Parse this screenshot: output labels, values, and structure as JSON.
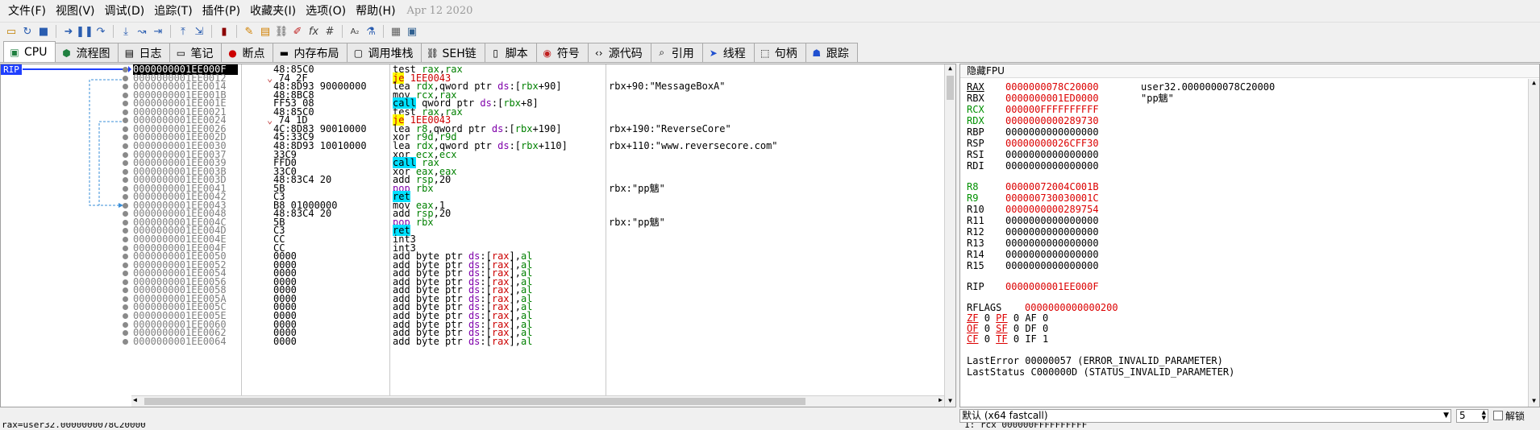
{
  "menu": [
    "文件(F)",
    "视图(V)",
    "调试(D)",
    "追踪(T)",
    "插件(P)",
    "收藏夹(I)",
    "选项(O)",
    "帮助(H)"
  ],
  "menu_date": "Apr 12 2020",
  "tabs": [
    {
      "label": "CPU",
      "icon": "cpu-icon",
      "active": true
    },
    {
      "label": "流程图",
      "icon": "graph-icon"
    },
    {
      "label": "日志",
      "icon": "log-icon"
    },
    {
      "label": "笔记",
      "icon": "notes-icon"
    },
    {
      "label": "断点",
      "icon": "breakpoint-icon"
    },
    {
      "label": "内存布局",
      "icon": "memory-icon"
    },
    {
      "label": "调用堆栈",
      "icon": "callstack-icon"
    },
    {
      "label": "SEH链",
      "icon": "seh-icon"
    },
    {
      "label": "脚本",
      "icon": "script-icon"
    },
    {
      "label": "符号",
      "icon": "symbol-icon"
    },
    {
      "label": "源代码",
      "icon": "source-icon"
    },
    {
      "label": "引用",
      "icon": "reference-icon"
    },
    {
      "label": "线程",
      "icon": "thread-icon"
    },
    {
      "label": "句柄",
      "icon": "handle-icon"
    },
    {
      "label": "跟踪",
      "icon": "trace-icon"
    }
  ],
  "rip_label": "RIP",
  "disasm": [
    {
      "addr": "0000000001EE000F",
      "bytes": "48:85C0",
      "dis": "test rax,rax",
      "cmt": "",
      "cur": true
    },
    {
      "addr": "0000000001EE0012",
      "bytes": "74 2F",
      "dis": "je 1EE0043",
      "cmt": "",
      "jmp": true,
      "arrow": "v"
    },
    {
      "addr": "0000000001EE0014",
      "bytes": "48:8D93 90000000",
      "dis": "lea rdx,qword ptr ds:[rbx+90]",
      "cmt": "rbx+90:\"MessageBoxA\""
    },
    {
      "addr": "0000000001EE001B",
      "bytes": "48:8BC8",
      "dis": "mov rcx,rax",
      "cmt": ""
    },
    {
      "addr": "0000000001EE001E",
      "bytes": "FF53 08",
      "dis": "call qword ptr ds:[rbx+8]",
      "cmt": "",
      "call": true
    },
    {
      "addr": "0000000001EE0021",
      "bytes": "48:85C0",
      "dis": "test rax,rax",
      "cmt": ""
    },
    {
      "addr": "0000000001EE0024",
      "bytes": "74 1D",
      "dis": "je 1EE0043",
      "cmt": "",
      "jmp": true,
      "arrow": "v"
    },
    {
      "addr": "0000000001EE0026",
      "bytes": "4C:8D83 90010000",
      "dis": "lea r8,qword ptr ds:[rbx+190]",
      "cmt": "rbx+190:\"ReverseCore\""
    },
    {
      "addr": "0000000001EE002D",
      "bytes": "45:33C9",
      "dis": "xor r9d,r9d",
      "cmt": ""
    },
    {
      "addr": "0000000001EE0030",
      "bytes": "48:8D93 10010000",
      "dis": "lea rdx,qword ptr ds:[rbx+110]",
      "cmt": "rbx+110:\"www.reversecore.com\""
    },
    {
      "addr": "0000000001EE0037",
      "bytes": "33C9",
      "dis": "xor ecx,ecx",
      "cmt": ""
    },
    {
      "addr": "0000000001EE0039",
      "bytes": "FFD0",
      "dis": "call rax",
      "cmt": "",
      "call": true
    },
    {
      "addr": "0000000001EE003B",
      "bytes": "33C0",
      "dis": "xor eax,eax",
      "cmt": ""
    },
    {
      "addr": "0000000001EE003D",
      "bytes": "48:83C4 20",
      "dis": "add rsp,20",
      "cmt": ""
    },
    {
      "addr": "0000000001EE0041",
      "bytes": "5B",
      "dis": "pop rbx",
      "cmt": "rbx:\"pp魑\""
    },
    {
      "addr": "0000000001EE0042",
      "bytes": "C3",
      "dis": "ret",
      "cmt": "",
      "ret": true
    },
    {
      "addr": "0000000001EE0043",
      "bytes": "B8 01000000",
      "dis": "mov eax,1",
      "cmt": ""
    },
    {
      "addr": "0000000001EE0048",
      "bytes": "48:83C4 20",
      "dis": "add rsp,20",
      "cmt": ""
    },
    {
      "addr": "0000000001EE004C",
      "bytes": "5B",
      "dis": "pop rbx",
      "cmt": "rbx:\"pp魑\""
    },
    {
      "addr": "0000000001EE004D",
      "bytes": "C3",
      "dis": "ret",
      "cmt": "",
      "ret": true
    },
    {
      "addr": "0000000001EE004E",
      "bytes": "CC",
      "dis": "int3",
      "cmt": ""
    },
    {
      "addr": "0000000001EE004F",
      "bytes": "CC",
      "dis": "int3",
      "cmt": ""
    },
    {
      "addr": "0000000001EE0050",
      "bytes": "0000",
      "dis": "add byte ptr ds:[rax],al",
      "cmt": ""
    },
    {
      "addr": "0000000001EE0052",
      "bytes": "0000",
      "dis": "add byte ptr ds:[rax],al",
      "cmt": ""
    },
    {
      "addr": "0000000001EE0054",
      "bytes": "0000",
      "dis": "add byte ptr ds:[rax],al",
      "cmt": ""
    },
    {
      "addr": "0000000001EE0056",
      "bytes": "0000",
      "dis": "add byte ptr ds:[rax],al",
      "cmt": ""
    },
    {
      "addr": "0000000001EE0058",
      "bytes": "0000",
      "dis": "add byte ptr ds:[rax],al",
      "cmt": ""
    },
    {
      "addr": "0000000001EE005A",
      "bytes": "0000",
      "dis": "add byte ptr ds:[rax],al",
      "cmt": ""
    },
    {
      "addr": "0000000001EE005C",
      "bytes": "0000",
      "dis": "add byte ptr ds:[rax],al",
      "cmt": ""
    },
    {
      "addr": "0000000001EE005E",
      "bytes": "0000",
      "dis": "add byte ptr ds:[rax],al",
      "cmt": ""
    },
    {
      "addr": "0000000001EE0060",
      "bytes": "0000",
      "dis": "add byte ptr ds:[rax],al",
      "cmt": ""
    },
    {
      "addr": "0000000001EE0062",
      "bytes": "0000",
      "dis": "add byte ptr ds:[rax],al",
      "cmt": ""
    },
    {
      "addr": "0000000001EE0064",
      "bytes": "0000",
      "dis": "add byte ptr ds:[rax],al",
      "cmt": ""
    }
  ],
  "registers_title": "隐藏FPU",
  "registers": [
    {
      "name": "RAX",
      "value": "0000000078C20000",
      "cmt": "user32.0000000078C20000",
      "red": true,
      "ul": true
    },
    {
      "name": "RBX",
      "value": "0000000001ED0000",
      "cmt": "\"pp魑\"",
      "red": true
    },
    {
      "name": "RCX",
      "value": "000000FFFFFFFFFF",
      "cmt": "",
      "red": true,
      "green": true
    },
    {
      "name": "RDX",
      "value": "0000000000289730",
      "cmt": "",
      "red": true,
      "green": true
    },
    {
      "name": "RBP",
      "value": "0000000000000000",
      "cmt": ""
    },
    {
      "name": "RSP",
      "value": "00000000026CFF30",
      "cmt": "",
      "red": true
    },
    {
      "name": "RSI",
      "value": "0000000000000000",
      "cmt": ""
    },
    {
      "name": "RDI",
      "value": "0000000000000000",
      "cmt": ""
    }
  ],
  "registers2": [
    {
      "name": "R8",
      "value": "00000072004C001B",
      "red": true,
      "green": true
    },
    {
      "name": "R9",
      "value": "000000730030001C",
      "red": true,
      "green": true
    },
    {
      "name": "R10",
      "value": "0000000000289754",
      "red": true
    },
    {
      "name": "R11",
      "value": "0000000000000000"
    },
    {
      "name": "R12",
      "value": "0000000000000000"
    },
    {
      "name": "R13",
      "value": "0000000000000000"
    },
    {
      "name": "R14",
      "value": "0000000000000000"
    },
    {
      "name": "R15",
      "value": "0000000000000000"
    }
  ],
  "rip": {
    "name": "RIP",
    "value": "0000000001EE000F"
  },
  "rflags": {
    "name": "RFLAGS",
    "value": "0000000000000200"
  },
  "flags": [
    [
      {
        "n": "ZF",
        "v": "0"
      },
      {
        "n": "PF",
        "v": "0"
      },
      {
        "n": "AF",
        "v": "0"
      }
    ],
    [
      {
        "n": "OF",
        "v": "0"
      },
      {
        "n": "SF",
        "v": "0"
      },
      {
        "n": "DF",
        "v": "0"
      }
    ],
    [
      {
        "n": "CF",
        "v": "0"
      },
      {
        "n": "TF",
        "v": "0"
      },
      {
        "n": "IF",
        "v": "1"
      }
    ]
  ],
  "last_error": "LastError  00000057 (ERROR_INVALID_PARAMETER)",
  "last_status": "LastStatus C000000D (STATUS_INVALID_PARAMETER)",
  "callconv": "默认 (x64 fastcall)",
  "argcount": "5",
  "unlock_label": "解锁",
  "status_left": "rax=user32.0000000078C20000",
  "status_right": "1: rcx 000000FFFFFFFFFF",
  "colors": {
    "jmp_bg": "#ffff00",
    "call_bg": "#00e0ff",
    "reg_changed": "#dc0000",
    "rip_bg": "#2040ff"
  }
}
